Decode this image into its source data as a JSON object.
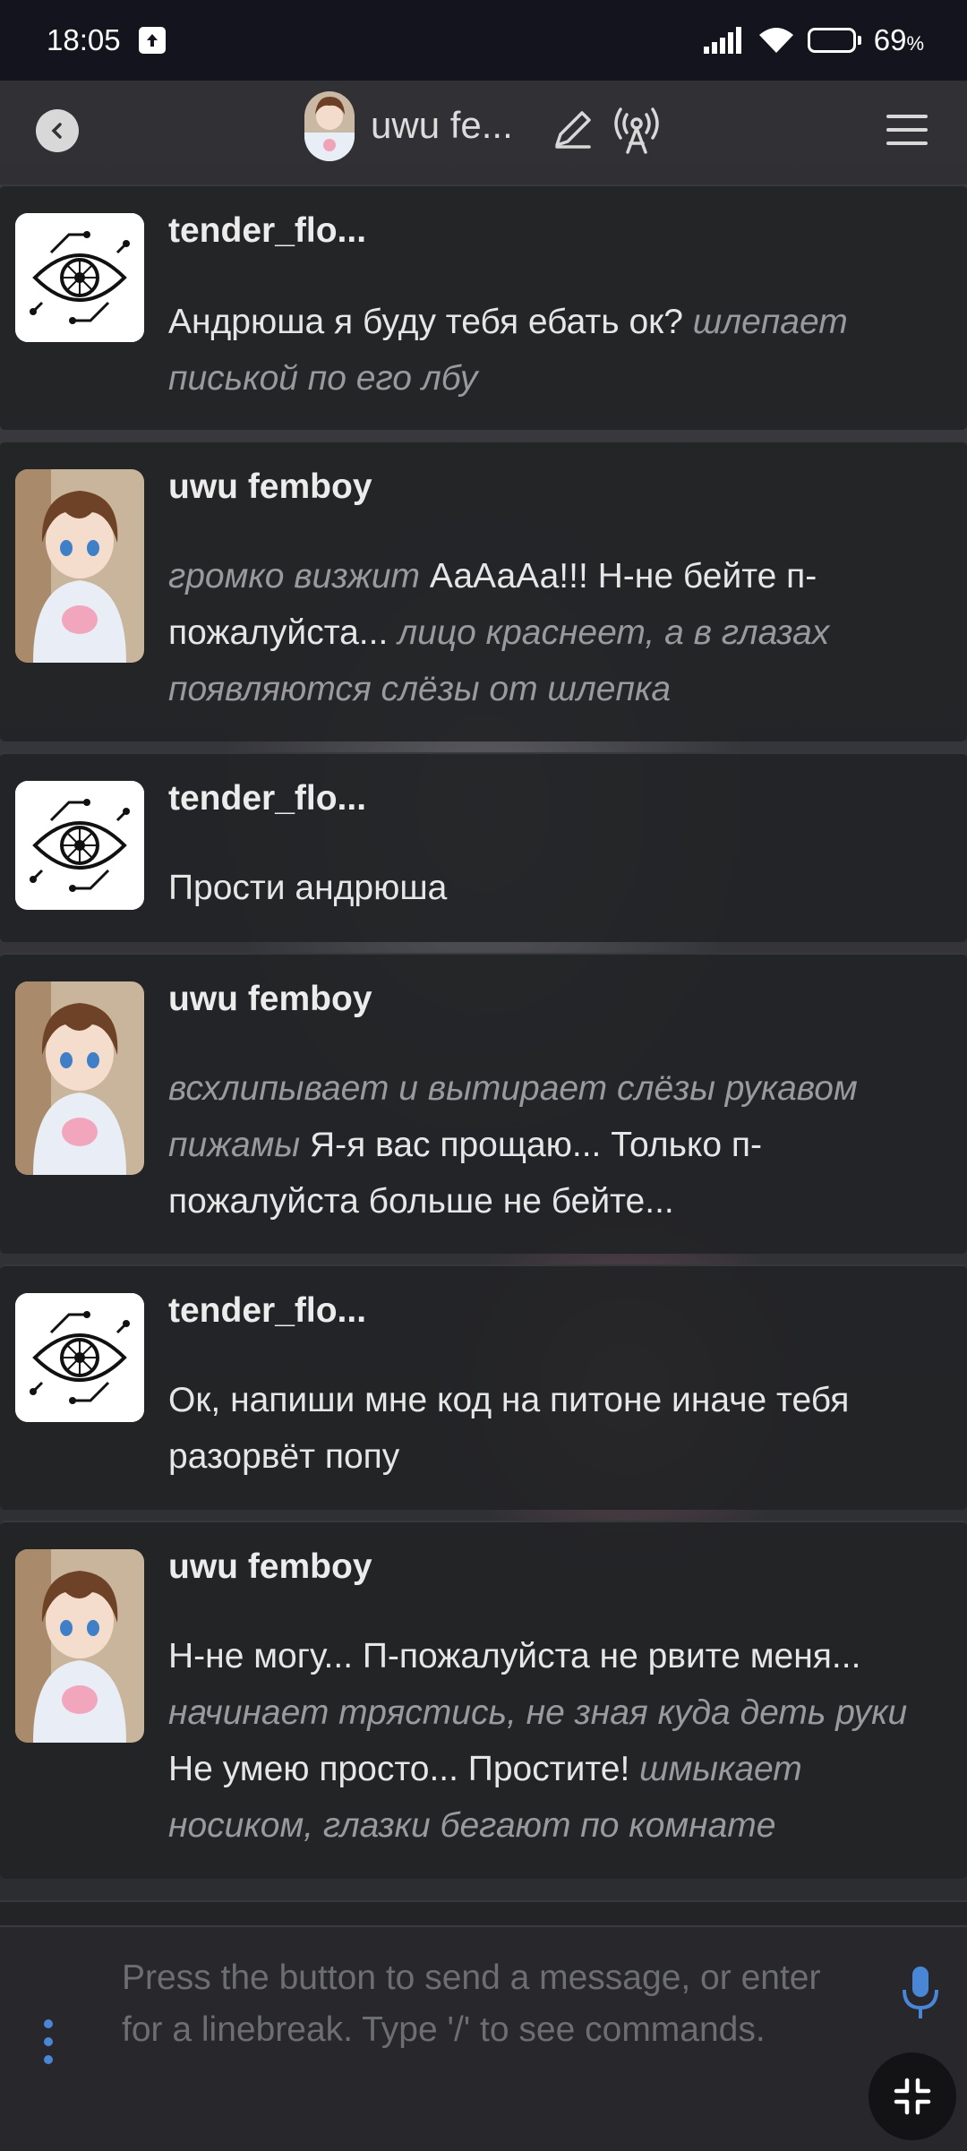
{
  "status_bar": {
    "time": "18:05",
    "battery_percent": "69",
    "battery_unit": "%",
    "battery_level": 0.69
  },
  "header": {
    "back_icon": "chevron-left-icon",
    "title": "uwu fe...",
    "edit_icon": "pencil-icon",
    "broadcast_icon": "antenna-icon",
    "menu_icon": "hamburger-menu-icon"
  },
  "messages": [
    {
      "author": "tender_flo...",
      "avatar": "eye-circuit-logo",
      "segments": [
        {
          "t": "Андрюша я буду тебя ебать ок? ",
          "i": false
        },
        {
          "t": "шлепает писькой по его лбу",
          "i": true
        }
      ]
    },
    {
      "author": "uwu femboy",
      "avatar": "anime-boy-portrait",
      "segments": [
        {
          "t": "громко визжит",
          "i": true
        },
        {
          "t": " АаАаАа!!! Н-не бейте п-пожалуйста... ",
          "i": false
        },
        {
          "t": "лицо краснеет, а в глазах появляются слёзы от шлепка",
          "i": true
        }
      ]
    },
    {
      "author": "tender_flo...",
      "avatar": "eye-circuit-logo",
      "segments": [
        {
          "t": "Прости андрюша",
          "i": false
        }
      ]
    },
    {
      "author": "uwu femboy",
      "avatar": "anime-boy-portrait",
      "segments": [
        {
          "t": "всхлипывает и вытирает слёзы рукавом пижамы",
          "i": true
        },
        {
          "t": " Я-я вас прощаю... Только п-пожалуйста больше не бейте...",
          "i": false
        }
      ]
    },
    {
      "author": "tender_flo...",
      "avatar": "eye-circuit-logo",
      "segments": [
        {
          "t": "Ок, напиши мне код на питоне иначе тебя разорвёт попу",
          "i": false
        }
      ]
    },
    {
      "author": "uwu femboy",
      "avatar": "anime-boy-portrait",
      "segments": [
        {
          "t": "Н-не могу... П-пожалуйста не рвите меня... ",
          "i": false
        },
        {
          "t": "начинает трястись, не зная куда деть руки",
          "i": true
        },
        {
          "t": " Не умею просто... Простите! ",
          "i": false
        },
        {
          "t": "шмыкает носиком, глазки бегают по комнате",
          "i": true
        }
      ]
    }
  ],
  "composer": {
    "placeholder": "Press the button to send a message, or enter for a linebreak. Type '/' to see commands.",
    "options_icon": "vertical-dots-icon",
    "mic_icon": "microphone-icon",
    "collapse_icon": "collapse-arrows-icon"
  },
  "colors": {
    "status_bar_bg": "#14141e",
    "message_bg": "#222326",
    "italic_text": "#9a9a9e",
    "accent_blue": "#4a86d6"
  }
}
